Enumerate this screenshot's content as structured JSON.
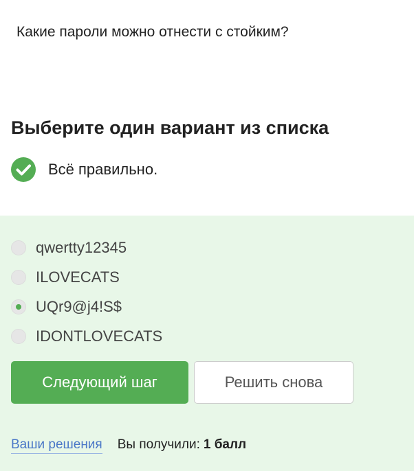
{
  "question": {
    "text": "Какие пароли можно отнести с стойким?"
  },
  "task": {
    "title": "Выберите один вариант из списка"
  },
  "feedback": {
    "icon": "check-circle-icon",
    "text": "Всё правильно.",
    "color": "#54ad54"
  },
  "options": [
    {
      "label": "qwertty12345",
      "selected": false
    },
    {
      "label": "ILOVECATS",
      "selected": false
    },
    {
      "label": "UQr9@j4!S$",
      "selected": true
    },
    {
      "label": "IDONTLOVECATS",
      "selected": false
    }
  ],
  "buttons": {
    "next": "Следующий шаг",
    "retry": "Решить снова"
  },
  "footer": {
    "solutions_link": "Ваши решения",
    "score_label": "Вы получили:",
    "score_value": "1 балл"
  },
  "colors": {
    "accent": "#54ad54",
    "panel_background": "#e8f7e8",
    "link": "#4a77c7"
  }
}
